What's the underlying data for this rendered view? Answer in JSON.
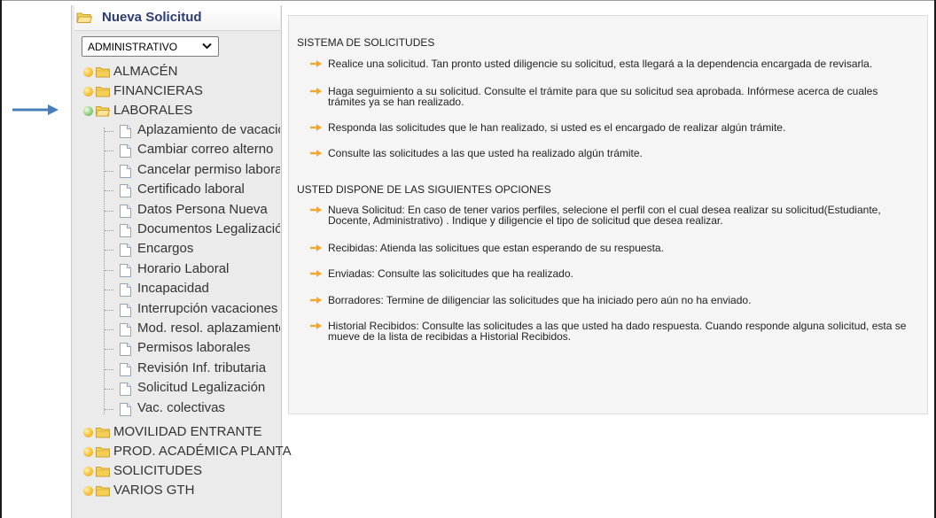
{
  "sidebar": {
    "title": "Nueva Solicitud",
    "perfil_select": {
      "value": "ADMINISTRATIVO"
    },
    "categories": [
      {
        "label": "ALMACÉN",
        "state": "closed"
      },
      {
        "label": "FINANCIERAS",
        "state": "closed"
      },
      {
        "label": "LABORALES",
        "state": "open"
      },
      {
        "label": "MOVILIDAD ENTRANTE",
        "state": "closed"
      },
      {
        "label": "PROD. ACADÉMICA PLANTA",
        "state": "closed"
      },
      {
        "label": "SOLICITUDES",
        "state": "closed"
      },
      {
        "label": "VARIOS GTH",
        "state": "closed"
      }
    ],
    "laborales_items": [
      "Aplazamiento de vacaciones",
      "Cambiar correo alterno",
      "Cancelar permiso laboral",
      "Certificado laboral",
      "Datos Persona Nueva",
      "Documentos Legalización",
      "Encargos",
      "Horario Laboral",
      "Incapacidad",
      "Interrupción vacaciones",
      "Mod. resol. aplazamiento",
      "Permisos laborales",
      "Revisión Inf. tributaria",
      "Solicitud Legalización",
      "Vac. colectivas"
    ]
  },
  "content": {
    "section1_title": "SISTEMA DE SOLICITUDES",
    "section1_items": [
      "Realice una solicitud. Tan pronto usted diligencie su solicitud, esta llegará a la dependencia encargada de revisarla.",
      "Haga seguimiento a su solicitud. Consulte el trámite para que su solicitud sea aprobada. Infórmese acerca de cuales trámites ya se han realizado.",
      "Responda las solicitudes que le han realizado, si usted es el encargado de realizar algún trámite.",
      "Consulte las solicitudes a las que usted ha realizado algún trámite."
    ],
    "section2_title": "USTED DISPONE DE LAS SIGUIENTES OPCIONES",
    "section2_items": [
      "Nueva Solicitud: En caso de tener varios perfiles, selecione el perfil con el cual desea realizar su solicitud(Estudiante, Docente, Administrativo) . Indique y diligencie el tipo de solicitud que desea realizar.",
      "Recibidas: Atienda las solicitues que estan esperando de su respuesta.",
      "Enviadas: Consulte las solicitudes que ha realizado.",
      "Borradores: Termine de diligenciar las solicitudes que ha iniciado pero aún no ha enviado.",
      "Historial Recibidos: Consulte las solicitudes a las que usted ha dado respuesta. Cuando responde alguna solicitud, esta se mueve de la lista de recibidas a Historial Recibidos."
    ]
  },
  "colors": {
    "header_text": "#2c3e6e",
    "pointer_arrow": "#4a7ebb",
    "item_arrow": "#f0a830",
    "folder": "#f5cf55"
  },
  "icons": {
    "pointer": "arrow-right-icon",
    "folder": "folder-icon",
    "document": "document-icon",
    "bullet": "bullet-icon",
    "item_arrow": "item-arrow-icon"
  }
}
